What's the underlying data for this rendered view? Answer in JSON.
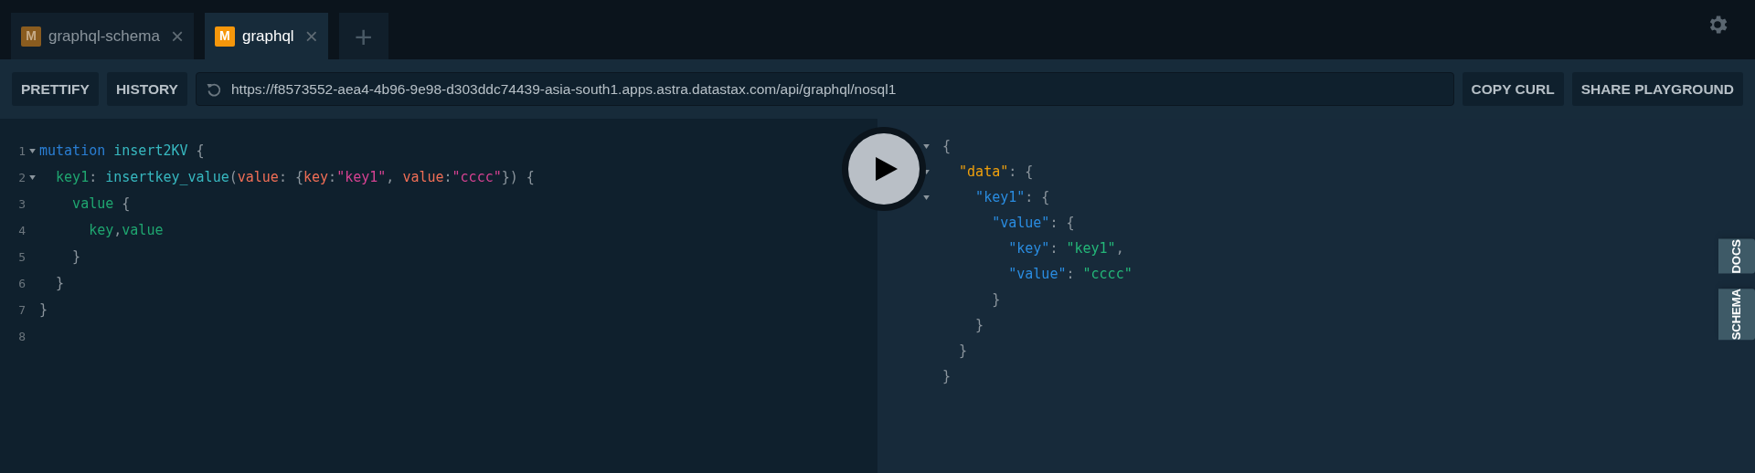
{
  "tabs": [
    {
      "badge": "M",
      "label": "graphql-schema",
      "close": "×",
      "selected": false
    },
    {
      "badge": "M",
      "label": "graphql",
      "close": "×",
      "selected": true
    }
  ],
  "new_tab": "+",
  "toolbar": {
    "buttons_left": [
      "PRETTIFY",
      "HISTORY"
    ],
    "url": "https://f8573552-aea4-4b96-9e98-d303ddc74439-asia-south1.apps.astra.datastax.com/api/graphql/nosql1",
    "buttons_right": [
      "COPY CURL",
      "SHARE PLAYGROUND"
    ]
  },
  "query_editor": {
    "lines": [
      {
        "number": "1",
        "foldable": true,
        "segments": [
          {
            "text": "mutation ",
            "kind": "keyword"
          },
          {
            "text": "insert2KV",
            "kind": "def"
          },
          {
            "text": " {",
            "kind": "punct"
          }
        ]
      },
      {
        "number": "2",
        "foldable": true,
        "segments": [
          {
            "text": "  key1",
            "kind": "field"
          },
          {
            "text": ": ",
            "kind": "punct"
          },
          {
            "text": "insertkey_value",
            "kind": "def"
          },
          {
            "text": "(",
            "kind": "punct"
          },
          {
            "text": "value",
            "kind": "attr"
          },
          {
            "text": ": {",
            "kind": "punct"
          },
          {
            "text": "key",
            "kind": "attr"
          },
          {
            "text": ":",
            "kind": "punct"
          },
          {
            "text": "\"key1\"",
            "kind": "string"
          },
          {
            "text": ", ",
            "kind": "punct"
          },
          {
            "text": "value",
            "kind": "attr"
          },
          {
            "text": ":",
            "kind": "punct"
          },
          {
            "text": "\"cccc\"",
            "kind": "string"
          },
          {
            "text": "}) {",
            "kind": "punct"
          }
        ]
      },
      {
        "number": "3",
        "foldable": false,
        "segments": [
          {
            "text": "    value",
            "kind": "field"
          },
          {
            "text": " {",
            "kind": "punct"
          }
        ]
      },
      {
        "number": "4",
        "foldable": false,
        "segments": [
          {
            "text": "      key",
            "kind": "field"
          },
          {
            "text": ",",
            "kind": "punct"
          },
          {
            "text": "value",
            "kind": "field"
          }
        ]
      },
      {
        "number": "5",
        "foldable": false,
        "segments": [
          {
            "text": "    }",
            "kind": "punct"
          }
        ]
      },
      {
        "number": "6",
        "foldable": false,
        "segments": [
          {
            "text": "  }",
            "kind": "punct"
          }
        ]
      },
      {
        "number": "7",
        "foldable": false,
        "segments": [
          {
            "text": "}",
            "kind": "punct"
          }
        ]
      },
      {
        "number": "8",
        "foldable": false
      }
    ]
  },
  "result": {
    "lines": [
      {
        "foldable": true,
        "segments": [
          {
            "text": "{",
            "kind": "punct"
          }
        ]
      },
      {
        "foldable": true,
        "segments": [
          {
            "text": "  \"data\"",
            "kind": "root"
          },
          {
            "text": ": {",
            "kind": "punct"
          }
        ]
      },
      {
        "foldable": true,
        "segments": [
          {
            "text": "    \"key1\"",
            "kind": "key"
          },
          {
            "text": ": {",
            "kind": "punct"
          }
        ]
      },
      {
        "foldable": false,
        "segments": [
          {
            "text": "      \"value\"",
            "kind": "key"
          },
          {
            "text": ": {",
            "kind": "punct"
          }
        ]
      },
      {
        "foldable": false,
        "segments": [
          {
            "text": "        \"key\"",
            "kind": "key"
          },
          {
            "text": ": ",
            "kind": "punct"
          },
          {
            "text": "\"key1\"",
            "kind": "value"
          },
          {
            "text": ",",
            "kind": "punct"
          }
        ]
      },
      {
        "foldable": false,
        "segments": [
          {
            "text": "        \"value\"",
            "kind": "key"
          },
          {
            "text": ": ",
            "kind": "punct"
          },
          {
            "text": "\"cccc\"",
            "kind": "value"
          }
        ]
      },
      {
        "foldable": false,
        "segments": [
          {
            "text": "      }",
            "kind": "punct"
          }
        ]
      },
      {
        "foldable": false,
        "segments": [
          {
            "text": "    }",
            "kind": "punct"
          }
        ]
      },
      {
        "foldable": false,
        "segments": [
          {
            "text": "  }",
            "kind": "punct"
          }
        ]
      },
      {
        "foldable": false,
        "segments": [
          {
            "text": "}",
            "kind": "punct"
          }
        ]
      }
    ]
  },
  "side_tabs": [
    "DOCS",
    "SCHEMA"
  ]
}
